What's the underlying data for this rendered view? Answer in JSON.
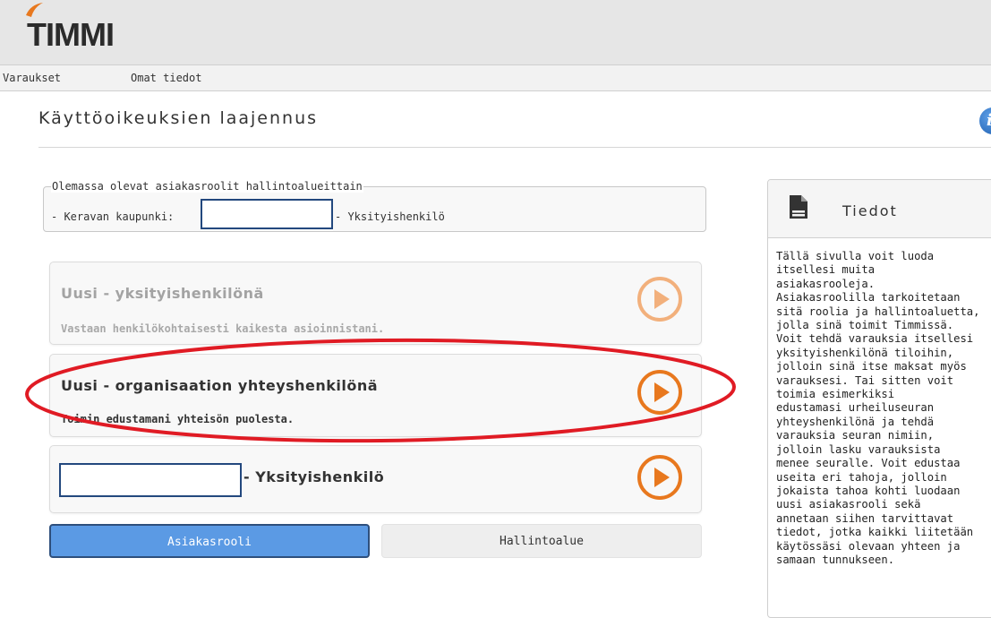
{
  "app": {
    "logo_text": "TIMMI"
  },
  "nav": {
    "items": [
      "Varaukset",
      "Omat tiedot"
    ]
  },
  "page": {
    "title": "Käyttöoikeuksien laajennus",
    "info_icon": "i"
  },
  "existing_roles": {
    "legend": "Olemassa olevat asiakasroolit hallintoalueittain",
    "prefix": "- Keravan kaupunki:",
    "suffix": "- Yksityishenkilö"
  },
  "options": [
    {
      "title": "Uusi - yksityishenkilönä",
      "description": "Vastaan henkilökohtaisesti kaikesta asioinnistani.",
      "state": "disabled"
    },
    {
      "title": "Uusi - organisaation yhteyshenkilönä",
      "description": "Toimin edustamani yhteisön puolesta.",
      "state": "active"
    },
    {
      "title": "- Yksityishenkilö",
      "description": "",
      "state": "active"
    }
  ],
  "tabs": {
    "role": "Asiakasrooli",
    "area": "Hallintoalue"
  },
  "info_panel": {
    "title": "Tiedot",
    "lines": [
      "Tällä sivulla voit luoda",
      "itsellesi muita",
      "asiakasrooleja.",
      "Asiakasroolilla tarkoitetaan",
      "sitä roolia ja hallintoaluetta,",
      "jolla sinä toimit Timmissä.",
      "Voit tehdä varauksia itsellesi",
      "yksityishenkilönä tiloihin,",
      "jolloin sinä itse maksat myös",
      "varauksesi. Tai sitten voit",
      "toimia esimerkiksi",
      "edustamasi urheiluseuran",
      "yhteyshenkilönä ja tehdä",
      "varauksia seuran nimiin,",
      "jolloin lasku varauksista",
      "menee seuralle. Voit edustaa",
      "useita eri tahoja, jolloin",
      "jokaista tahoa kohti luodaan",
      "uusi asiakasrooli sekä",
      "annetaan siihen tarvittavat",
      "tiedot, jotka kaikki liitetään",
      "käytössäsi olevaan yhteen ja",
      "samaan tunnukseen."
    ]
  },
  "colors": {
    "accent_orange": "#e8781e",
    "disabled_orange": "#f2b07c",
    "primary_blue": "#5b9ae4",
    "annotation_red": "#e01b24"
  },
  "icons": [
    "logo-check-icon",
    "info-icon",
    "document-icon",
    "play-icon"
  ]
}
